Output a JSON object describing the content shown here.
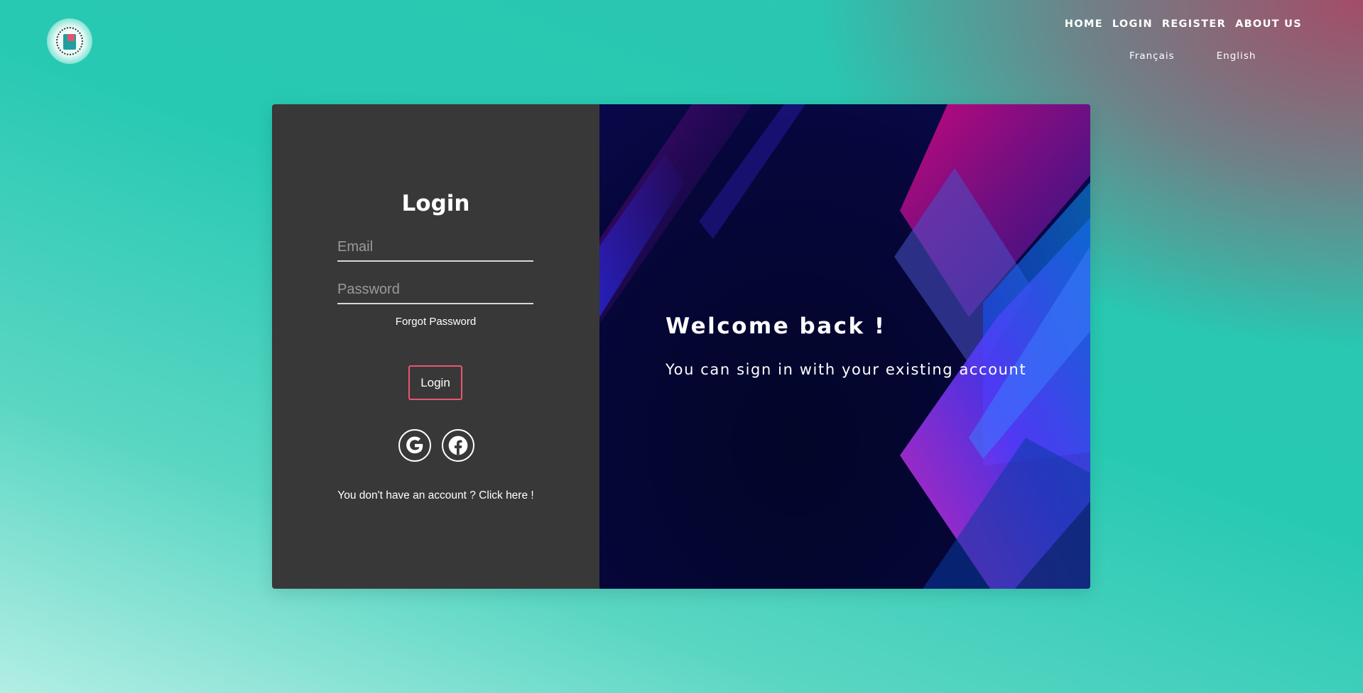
{
  "nav": {
    "home": "HOME",
    "login": "LOGIN",
    "register": "REGISTER",
    "about": "ABOUT US"
  },
  "languages": {
    "french": "Français",
    "english": "English"
  },
  "login_form": {
    "title": "Login",
    "email_placeholder": "Email",
    "password_placeholder": "Password",
    "forgot_password": "Forgot Password",
    "login_button": "Login",
    "signup_text": "You don't have an account ? Click here !"
  },
  "welcome_panel": {
    "heading": "Welcome back !",
    "subtitle": "You can sign in with your existing account"
  },
  "icons": {
    "google": "google-icon",
    "facebook": "facebook-icon",
    "logo": "app-logo"
  },
  "colors": {
    "accent_border": "#e8576f",
    "card_left": "#383838",
    "bg_teal": "#27c9b2",
    "bg_rose": "#aa4664"
  }
}
